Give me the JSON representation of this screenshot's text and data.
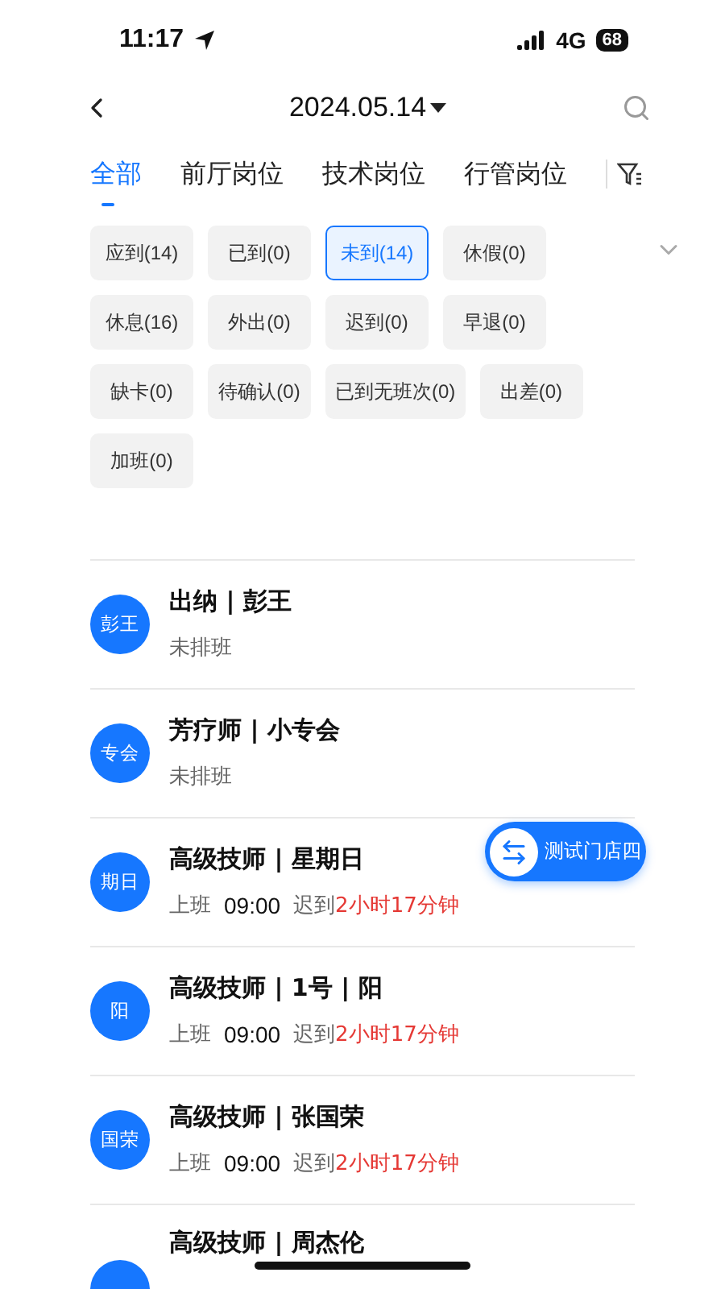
{
  "status_bar": {
    "time": "11:17",
    "network": "4G",
    "battery": "68"
  },
  "header": {
    "date": "2024.05.14"
  },
  "tabs": [
    {
      "label": "全部",
      "selected": true
    },
    {
      "label": "前厅岗位",
      "selected": false
    },
    {
      "label": "技术岗位",
      "selected": false
    },
    {
      "label": "行管岗位",
      "selected": false
    }
  ],
  "filters": [
    {
      "label": "应到(14)",
      "selected": false
    },
    {
      "label": "已到(0)",
      "selected": false
    },
    {
      "label": "未到(14)",
      "selected": true
    },
    {
      "label": "休假(0)",
      "selected": false
    },
    {
      "label": "休息(16)",
      "selected": false
    },
    {
      "label": "外出(0)",
      "selected": false
    },
    {
      "label": "迟到(0)",
      "selected": false
    },
    {
      "label": "早退(0)",
      "selected": false
    },
    {
      "label": "缺卡(0)",
      "selected": false
    },
    {
      "label": "待确认(0)",
      "selected": false
    },
    {
      "label": "已到无班次(0)",
      "selected": false
    },
    {
      "label": "出差(0)",
      "selected": false
    },
    {
      "label": "加班(0)",
      "selected": false
    }
  ],
  "staff": [
    {
      "kind": "unscheduled",
      "avatar": "彭王",
      "title": "出纳 | 彭王",
      "status": "未排班"
    },
    {
      "kind": "unscheduled",
      "avatar": "专会",
      "title": "芳疗师 | 小专会",
      "status": "未排班"
    },
    {
      "kind": "late",
      "avatar": "期日",
      "title": "高级技师 | 星期日",
      "shift_label": "上班",
      "time": "09:00",
      "late_label": "迟到",
      "late_value": "2小时17分钟"
    },
    {
      "kind": "late",
      "avatar": "阳",
      "title": "高级技师 | 1号 | 阳",
      "shift_label": "上班",
      "time": "09:00",
      "late_label": "迟到",
      "late_value": "2小时17分钟"
    },
    {
      "kind": "late",
      "avatar": "国荣",
      "title": "高级技师 | 张国荣",
      "shift_label": "上班",
      "time": "09:00",
      "late_label": "迟到",
      "late_value": "2小时17分钟"
    },
    {
      "kind": "cut",
      "title": "高级技师 | 周杰伦"
    }
  ],
  "store_button": {
    "label": "测试门店四"
  }
}
